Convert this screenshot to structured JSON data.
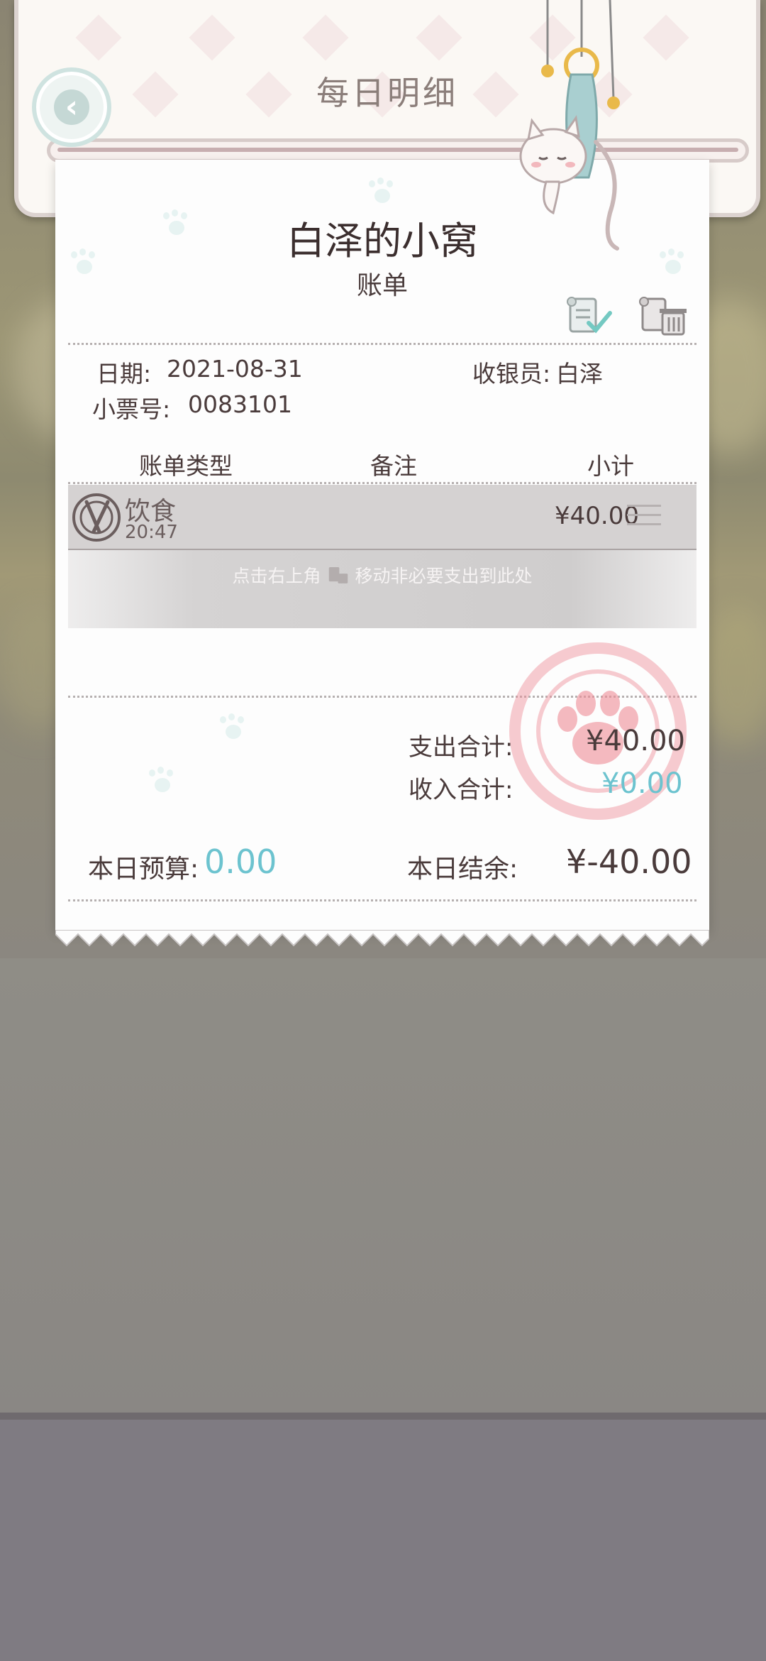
{
  "header": {
    "title": "每日明细",
    "back_icon": "chevron-left-icon"
  },
  "receipt": {
    "shop_name": "白泽的小窝",
    "subtitle": "账单",
    "date_label": "日期:",
    "date_value": "2021-08-31",
    "cashier_label": "收银员:",
    "cashier_value": "白泽",
    "ticket_label": "小票号:",
    "ticket_value": "0083101",
    "columns": [
      "账单类型",
      "备注",
      "小计"
    ],
    "entries": [
      {
        "category": "饮食",
        "time": "20:47",
        "note": "",
        "amount": "¥40.00",
        "icon": "dining-icon"
      }
    ],
    "hint_prefix": "点击右上角",
    "hint_suffix": "移动非必要支出到此处",
    "expense_label": "支出合计:",
    "expense_value": "¥40.00",
    "income_label": "收入合计:",
    "income_value": "¥0.00",
    "budget_label": "本日预算:",
    "budget_value": "0.00",
    "balance_label": "本日结余:",
    "balance_value": "¥-40.00"
  },
  "colors": {
    "accent_teal": "#6cc3cf",
    "text_dark": "#4a3b3b",
    "stamp_pink": "#ee8c96"
  }
}
